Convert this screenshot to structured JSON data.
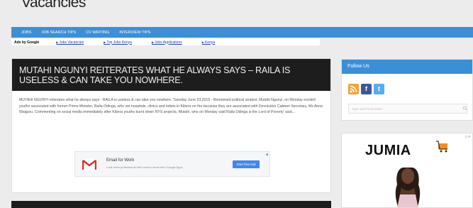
{
  "site": {
    "title": "Vacancies"
  },
  "nav": {
    "items": [
      "JOBS",
      "JOB SEARCH TIPS",
      "CV WRITING",
      "INTERVIEW TIPS"
    ]
  },
  "ads_bar": {
    "label": "Ads by Google",
    "links": [
      "Jobs Vacancies",
      "Top Jobs Kenya",
      "Jobs Applications",
      "Kenya"
    ]
  },
  "post": {
    "title": "MUTAHI NGUNYI REITERATES WHAT HE ALWAYS SAYS – RAILA IS USELESS & CAN TAKE YOU NOWHERE.",
    "excerpt": "MUTAHI NGUNYI reiterates what he always says - RAILA is useless & can take you nowhere. Tuesday June 23,2015 - Renowned political analyst, Mutahi Ngunyi, on Monday excited youths associated with former Prime Minister, Raila Odinga, who set hospitals, clinics and toilets in Kibera on fire because they are associated with Devolution Cabinet Secretary, Ms Anne Waiguru. Commenting on social media immediately after Kibera youths burnt down NYS projects, Mutahi, who on Monday said Raila Odinga is the Lord of Poverty' said..."
  },
  "inline_ad": {
    "title": "Email for Work",
    "description": "Look more professional with custom email from Google Apps",
    "button": "Start free trial"
  },
  "sidebar": {
    "follow_heading": "Follow Us",
    "search_placeholder": "Type and Press Enter",
    "ad_brand": "JUMIA"
  },
  "colors": {
    "accent_blue": "#3b8fd6",
    "title_bar": "#1d1d1d",
    "rss": "#f5a132",
    "facebook": "#3b5998",
    "twitter": "#55acee"
  },
  "icons": [
    "rss-icon",
    "facebook-icon",
    "twitter-icon",
    "search-icon",
    "gmail-icon",
    "cart-icon",
    "ad-choices-icon"
  ]
}
